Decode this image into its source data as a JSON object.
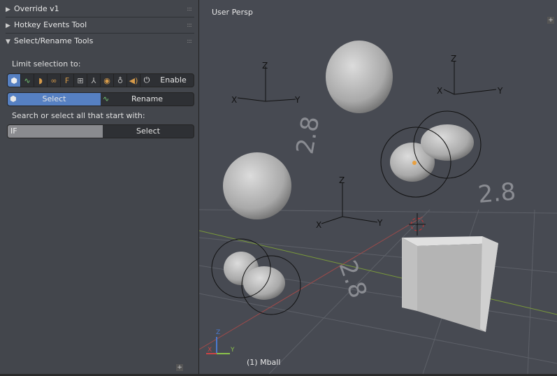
{
  "panel": {
    "headers": [
      {
        "label": "Override v1",
        "expanded": false
      },
      {
        "label": "Hotkey Events Tool",
        "expanded": false
      },
      {
        "label": "Select/Rename Tools",
        "expanded": true
      }
    ],
    "limit_label": "Limit selection to:",
    "filter_icons": [
      "mesh-icon",
      "curve-icon",
      "surface-icon",
      "metaball-icon",
      "text-icon",
      "lattice-icon",
      "empty-icon",
      "camera-icon",
      "lamp-icon",
      "speaker-icon"
    ],
    "enable_label": "Enable",
    "mode_select": "Select",
    "mode_rename": "Rename",
    "search_label": "Search or select all that start with:",
    "search_value": "F",
    "select_button": "Select"
  },
  "viewport": {
    "view_label": "User Persp",
    "object_label": "(1) Mball",
    "axis_labels": {
      "x": "X",
      "y": "Y",
      "z": "Z"
    },
    "text_objects": [
      "2.8",
      "2.8",
      "2.8"
    ]
  }
}
